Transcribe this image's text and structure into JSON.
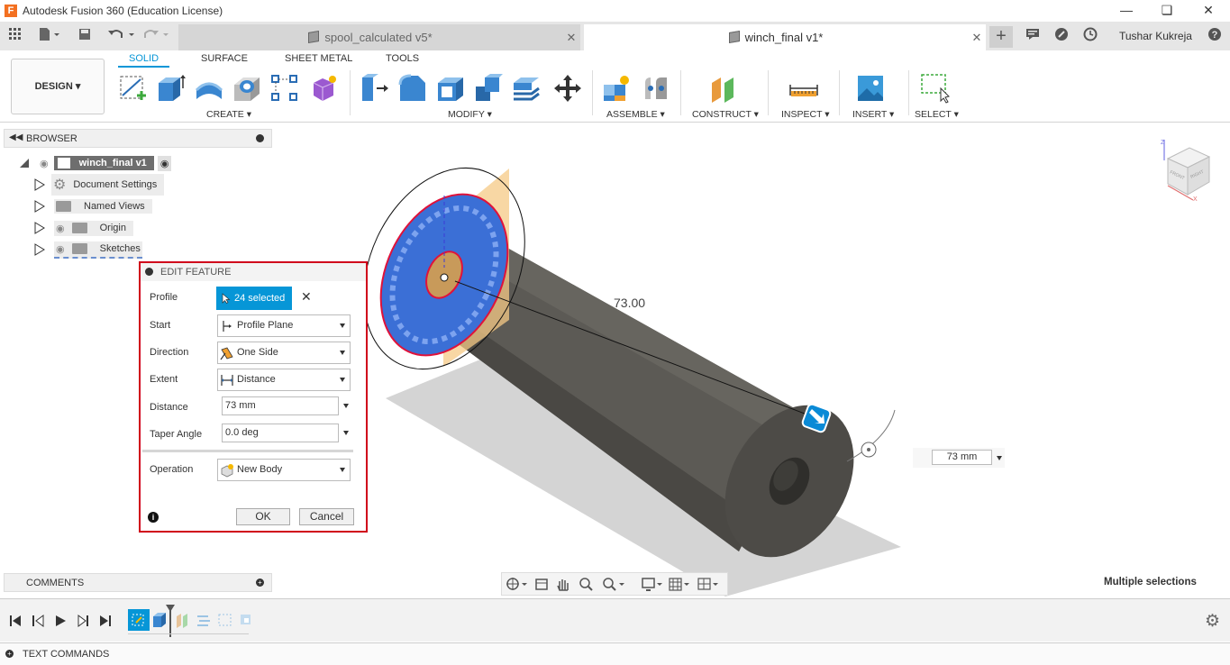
{
  "window": {
    "title": "Autodesk Fusion 360 (Education License)",
    "controls": [
      "minimize",
      "restore",
      "close"
    ]
  },
  "tabs": [
    {
      "label": "spool_calculated v5*",
      "active": false
    },
    {
      "label": "winch_final v1*",
      "active": true
    }
  ],
  "user": {
    "name": "Tushar Kukreja"
  },
  "toolbar": {
    "workspace": "DESIGN",
    "workspace_tabs": [
      "SOLID",
      "SURFACE",
      "SHEET METAL",
      "TOOLS"
    ],
    "groups": [
      "CREATE",
      "MODIFY",
      "ASSEMBLE",
      "CONSTRUCT",
      "INSPECT",
      "INSERT",
      "SELECT"
    ]
  },
  "browser": {
    "title": "BROWSER",
    "root": "winch_final v1",
    "items": [
      "Document Settings",
      "Named Views",
      "Origin",
      "Sketches"
    ]
  },
  "dialog": {
    "title": "EDIT FEATURE",
    "profile_label": "Profile",
    "profile_value": "24 selected",
    "start_label": "Start",
    "start_value": "Profile Plane",
    "direction_label": "Direction",
    "direction_value": "One Side",
    "extent_label": "Extent",
    "extent_value": "Distance",
    "distance_label": "Distance",
    "distance_value": "73 mm",
    "taper_label": "Taper Angle",
    "taper_value": "0.0 deg",
    "operation_label": "Operation",
    "operation_value": "New Body",
    "ok": "OK",
    "cancel": "Cancel"
  },
  "viewport": {
    "dimension_label": "73.00",
    "distance_input": "73 mm",
    "selection_status": "Multiple selections",
    "viewcube_faces": [
      "FRONT",
      "RIGHT"
    ]
  },
  "comments": {
    "title": "COMMENTS"
  },
  "text_commands": {
    "title": "TEXT COMMANDS"
  },
  "colors": {
    "accent": "#0696d7",
    "highlight_border": "#d0021b",
    "body": "#5a5853",
    "profile_fill": "#3b6fd6"
  }
}
